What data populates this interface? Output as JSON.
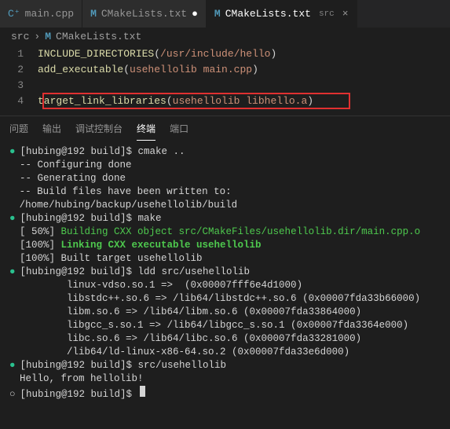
{
  "tabs": [
    {
      "icon": "C⁺",
      "label": "main.cpp"
    },
    {
      "icon": "M",
      "label": "CMakeLists.txt",
      "dirty": "●"
    },
    {
      "icon": "M",
      "label": "CMakeLists.txt",
      "suffix": "src",
      "close": "×"
    }
  ],
  "breadcrumb": {
    "root": "src",
    "sep": "›",
    "icon": "M",
    "file": "CMakeLists.txt"
  },
  "editor": {
    "lines": [
      {
        "n": "1",
        "fn": "INCLUDE_DIRECTORIES",
        "args": "/usr/include/hello"
      },
      {
        "n": "2",
        "fn": "add_executable",
        "args": "usehellolib main.cpp"
      },
      {
        "n": "3",
        "fn": "",
        "args": ""
      },
      {
        "n": "4",
        "fn": "target_link_libraries",
        "args": "usehellolib libhello.a"
      }
    ]
  },
  "panel": {
    "tabs": [
      "问题",
      "输出",
      "调试控制台",
      "终端",
      "端口"
    ],
    "active": 3
  },
  "terminal": [
    {
      "b": "g",
      "t": "[hubing@192 build]$ cmake .."
    },
    {
      "b": "",
      "t": "-- Configuring done"
    },
    {
      "b": "",
      "t": "-- Generating done"
    },
    {
      "b": "",
      "t": "-- Build files have been written to: /home/hubing/backup/usehellolib/build"
    },
    {
      "b": "g",
      "t": "[hubing@192 build]$ make"
    },
    {
      "b": "",
      "pre": "[ 50%] ",
      "grn": "Building CXX object src/CMakeFiles/usehellolib.dir/main.cpp.o"
    },
    {
      "b": "",
      "pre": "[100%] ",
      "grnb": "Linking CXX executable usehellolib"
    },
    {
      "b": "",
      "t": "[100%] Built target usehellolib"
    },
    {
      "b": "g",
      "t": "[hubing@192 build]$ ldd src/usehellolib"
    },
    {
      "b": "",
      "t": "        linux-vdso.so.1 =>  (0x00007fff6e4d1000)"
    },
    {
      "b": "",
      "t": "        libstdc++.so.6 => /lib64/libstdc++.so.6 (0x00007fda33b66000)"
    },
    {
      "b": "",
      "t": "        libm.so.6 => /lib64/libm.so.6 (0x00007fda33864000)"
    },
    {
      "b": "",
      "t": "        libgcc_s.so.1 => /lib64/libgcc_s.so.1 (0x00007fda3364e000)"
    },
    {
      "b": "",
      "t": "        libc.so.6 => /lib64/libc.so.6 (0x00007fda33281000)"
    },
    {
      "b": "",
      "t": "        /lib64/ld-linux-x86-64.so.2 (0x00007fda33e6d000)"
    },
    {
      "b": "g",
      "t": "[hubing@192 build]$ src/usehellolib"
    },
    {
      "b": "",
      "t": "Hello, from hellolib!"
    },
    {
      "b": "w",
      "t": "[hubing@192 build]$ ",
      "cursor": true
    }
  ]
}
